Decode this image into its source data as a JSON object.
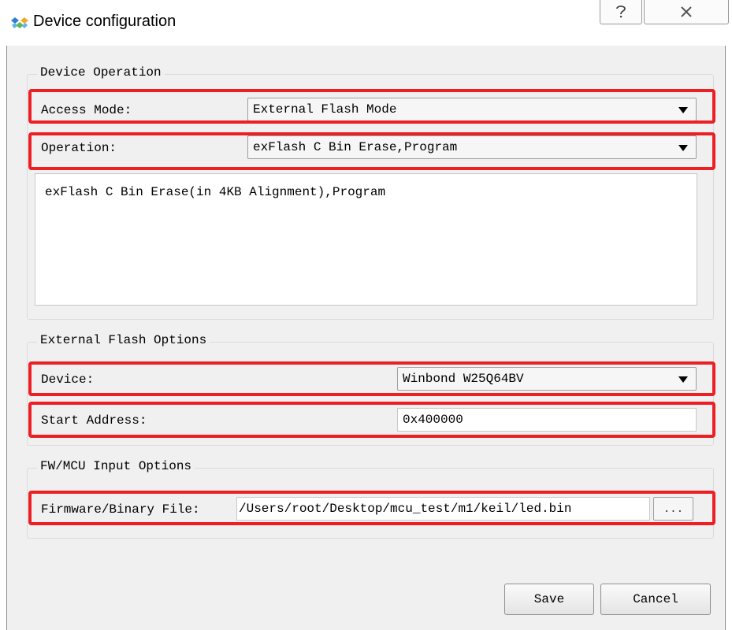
{
  "window": {
    "title": "Device configuration",
    "help_icon": "help-icon",
    "close_icon": "close-icon"
  },
  "device_operation": {
    "group_title": "Device Operation",
    "access_mode_label": "Access Mode:",
    "access_mode_value": "External Flash Mode",
    "operation_label": "Operation:",
    "operation_value": "exFlash C Bin Erase,Program",
    "description": "exFlash C Bin Erase(in 4KB Alignment),Program"
  },
  "external_flash_options": {
    "group_title": "External Flash Options",
    "device_label": "Device:",
    "device_value": "Winbond W25Q64BV",
    "start_address_label": "Start Address:",
    "start_address_value": "0x400000"
  },
  "fw_mcu_input_options": {
    "group_title": "FW/MCU Input Options",
    "file_label": "Firmware/Binary File:",
    "file_value": "/Users/root/Desktop/mcu_test/m1/keil/led.bin",
    "browse_label": "..."
  },
  "buttons": {
    "save": "Save",
    "cancel": "Cancel"
  },
  "colors": {
    "highlight": "#ec1f24",
    "dialog_bg": "#f0f0f0"
  }
}
